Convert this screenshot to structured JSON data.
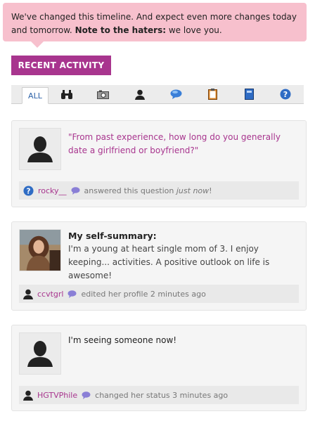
{
  "notice": {
    "text": "We've changed this timeline. And expect even more changes today and tomorrow.",
    "bold": "Note to the haters:",
    "tail": "we love you."
  },
  "recent_activity_label": "RECENT ACTIVITY",
  "tabs": {
    "all_label": "ALL",
    "icons": [
      "binoculars-icon",
      "camera-icon",
      "person-icon",
      "chat-bubble-icon",
      "clipboard-icon",
      "journal-icon",
      "question-icon"
    ]
  },
  "colors": {
    "accent": "#a8358e",
    "notice_bg": "#f7c0cd",
    "link_blue": "#2d62a8"
  },
  "activities": [
    {
      "text": "\"From past experience, how long do you generally date a girlfriend or boyfriend?\"",
      "user": "rocky__",
      "action": "answered this question",
      "time": "just now",
      "tail": "!"
    },
    {
      "title": "My self-summary:",
      "text": "I'm a young at heart single mom of 3. I enjoy keeping... activities. A positive outlook on life is awesome!",
      "user": "ccvtgrl",
      "action": "edited her profile 2 minutes ago"
    },
    {
      "text": "I'm seeing someone now!",
      "user": "HGTVPhile",
      "action": "changed her status 3 minutes ago"
    }
  ]
}
